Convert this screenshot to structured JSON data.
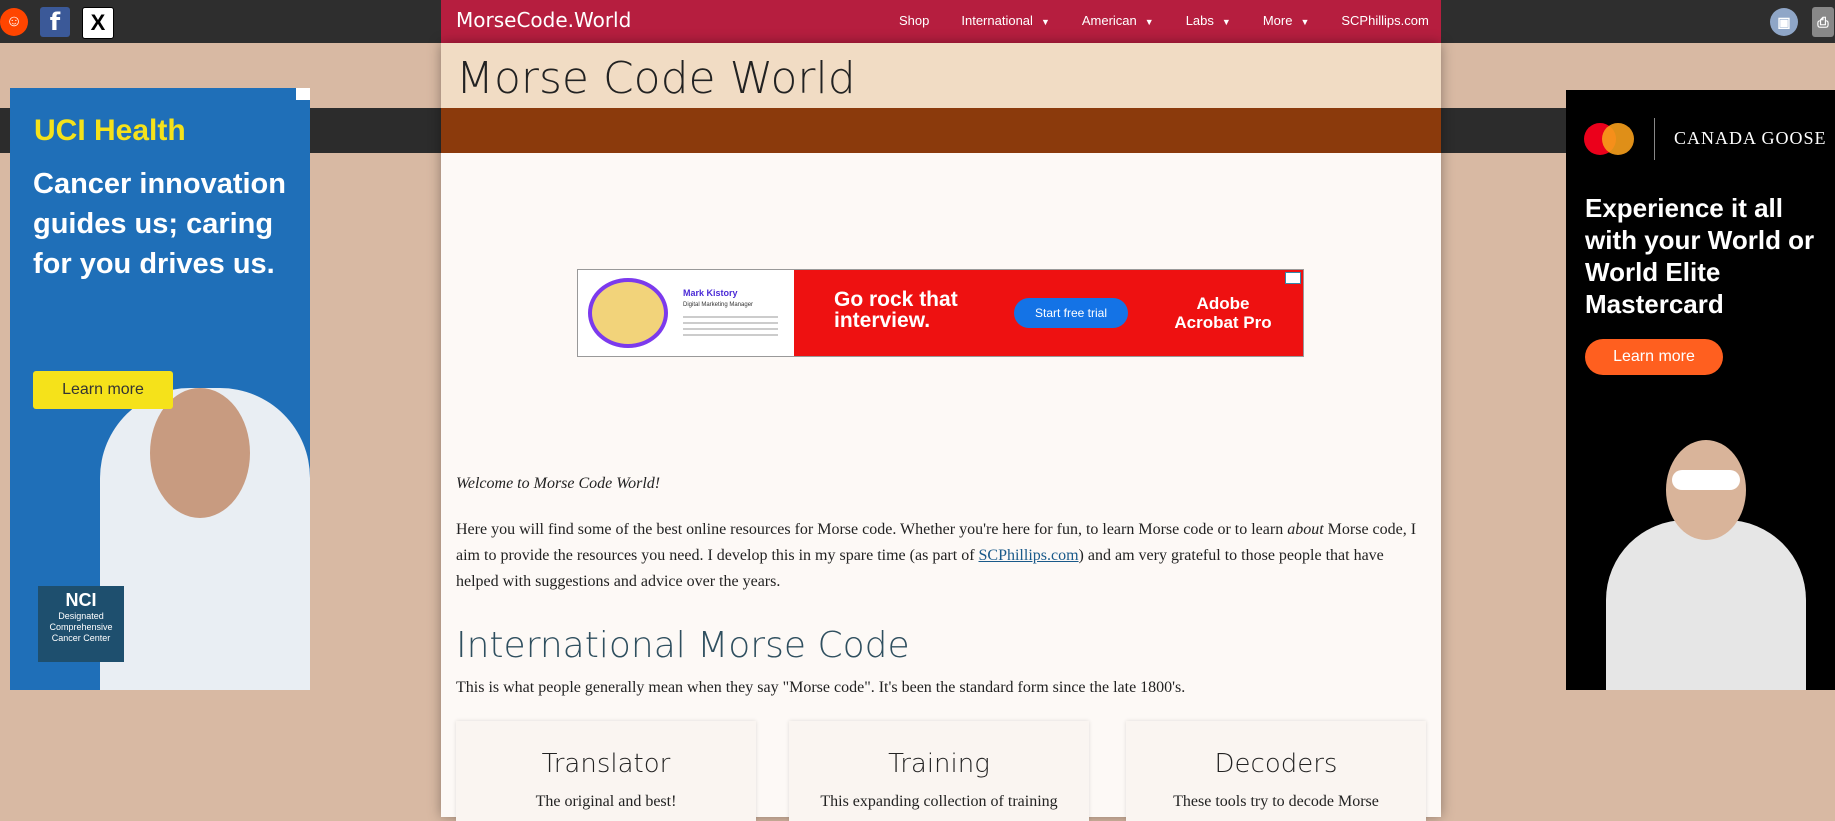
{
  "topbar": {
    "brand": "MorseCode.World",
    "nav": [
      {
        "label": "Shop",
        "has_menu": false
      },
      {
        "label": "International",
        "has_menu": true
      },
      {
        "label": "American",
        "has_menu": true
      },
      {
        "label": "Labs",
        "has_menu": true
      },
      {
        "label": "More",
        "has_menu": true
      },
      {
        "label": "SCPhillips.com",
        "has_menu": false
      }
    ],
    "social_icons": [
      "reddit-icon",
      "facebook-icon",
      "x-icon"
    ]
  },
  "page": {
    "title": "Morse Code World",
    "welcome": "Welcome to Morse Code World!",
    "intro_pre": "Here you will find some of the best online resources for Morse code. Whether you're here for fun, to learn Morse code or to learn ",
    "intro_em": "about",
    "intro_mid": " Morse code, I aim to provide the resources you need. I develop this in my spare time (as part of ",
    "intro_link": "SCPhillips.com",
    "intro_post": ") and am very grateful to those people that have helped with suggestions and advice over the years.",
    "section_title": "International Morse Code",
    "section_desc": "This is what people generally mean when they say \"Morse code\". It's been the standard form since the late 1800's.",
    "cards": [
      {
        "title": "Translator",
        "text": "The original and best!"
      },
      {
        "title": "Training",
        "text": "This expanding collection of training"
      },
      {
        "title": "Decoders",
        "text": "These tools try to decode Morse"
      }
    ]
  },
  "ads": {
    "center": {
      "name": "Mark Kistory",
      "role": "Digital Marketing Manager",
      "headline": "Go rock that interview.",
      "button": "Start free trial",
      "brand": "Adobe Acrobat Pro"
    },
    "left": {
      "brand": "UCI Health",
      "headline": "Cancer innovation guides us; caring for you drives us.",
      "button": "Learn more",
      "badge_title": "NCI",
      "badge_sub": "Designated Comprehensive Cancer Center"
    },
    "right": {
      "brand": "CANADA GOOSE",
      "headline": "Experience it all with your World or World Elite Mastercard",
      "button": "Learn more"
    }
  }
}
